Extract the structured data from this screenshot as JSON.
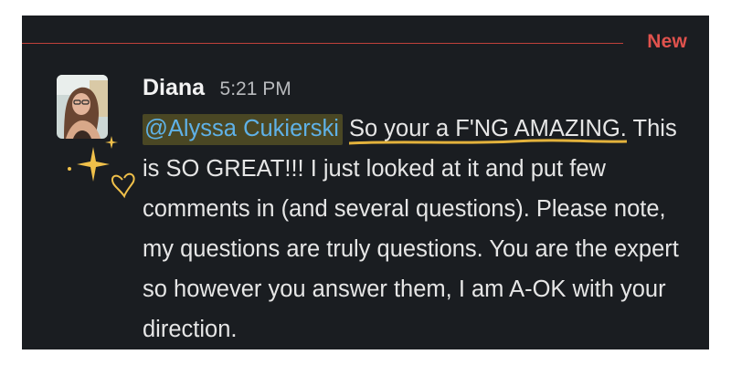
{
  "divider": {
    "label": "New",
    "color": "#e0524d"
  },
  "message": {
    "author": "Diana",
    "timestamp": "5:21 PM",
    "mention": "@Alyssa Cukierski",
    "highlight": "So your a F'NG AMAZING.",
    "body": "This is SO GREAT!!! I just looked at it and put few comments in (and several questions). Please note, my questions are truly questions. You are the expert so however you answer them, I am A-OK with your direction."
  },
  "colors": {
    "background": "#1a1d21",
    "mention_text": "#5fb1e6",
    "mention_bg": "#4a4724",
    "sparkle": "#f0c04a",
    "underline": "#e3b23c"
  },
  "icons": [
    "avatar-photo",
    "sparkle-stars-icon",
    "heart-outline-icon"
  ]
}
